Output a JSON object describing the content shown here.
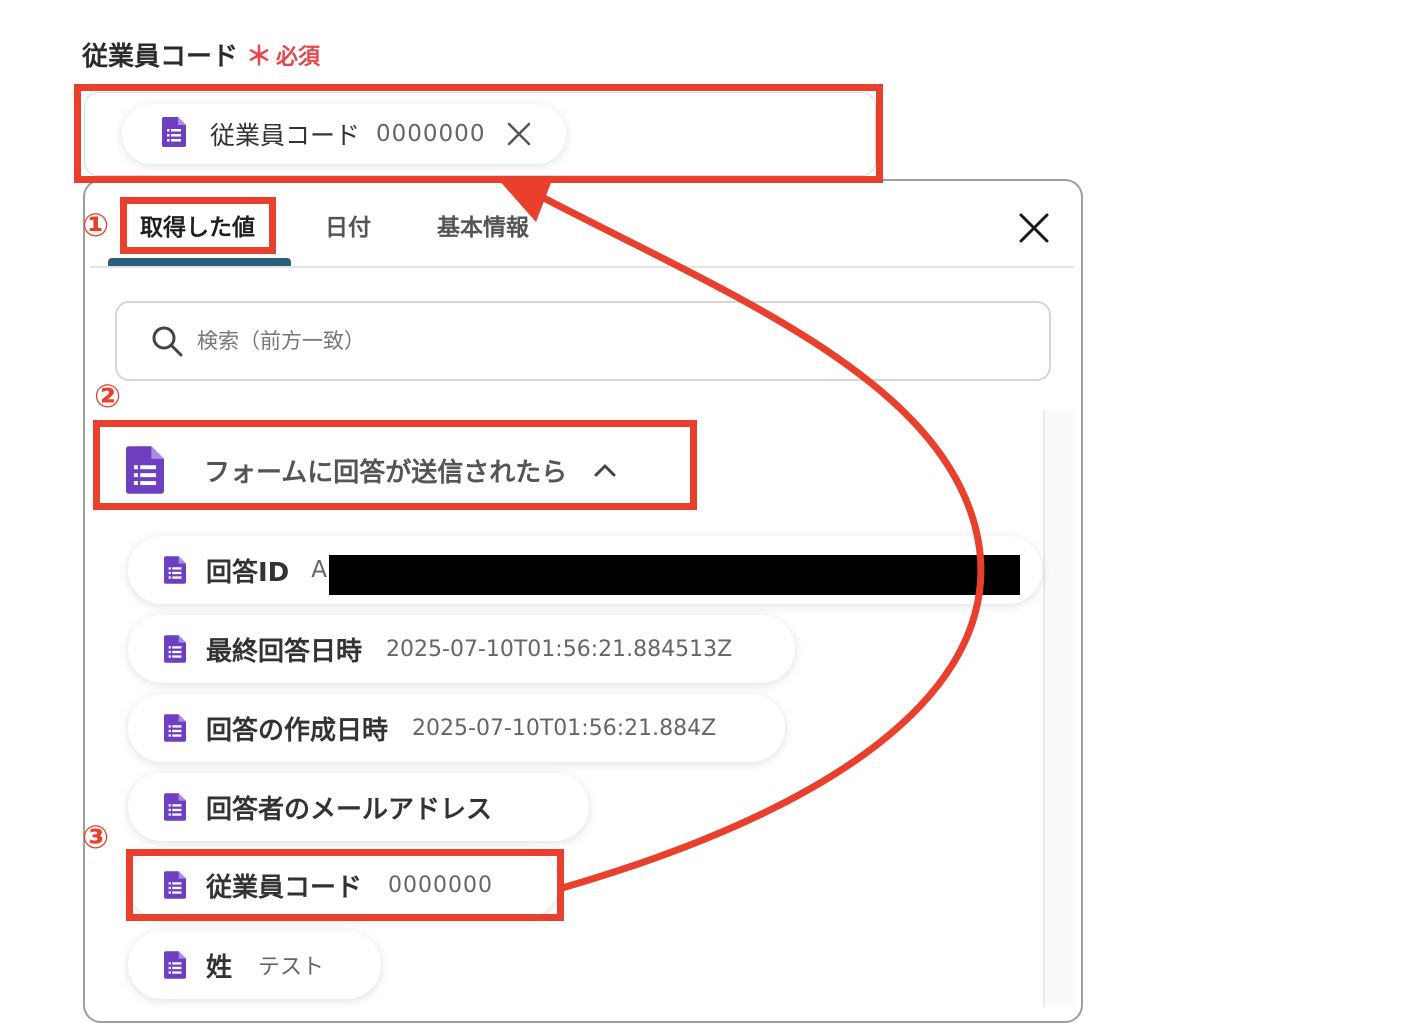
{
  "field": {
    "label": "従業員コード",
    "required_mark": "＊",
    "required_text": "必須",
    "chip": {
      "name": "従業員コード",
      "value": "0000000",
      "icon": "google-forms-icon",
      "remove_icon": "close-icon"
    }
  },
  "tabs": [
    {
      "label": "取得した値",
      "active": true
    },
    {
      "label": "日付",
      "active": false
    },
    {
      "label": "基本情報",
      "active": false
    }
  ],
  "search": {
    "placeholder": "検索（前方一致）",
    "icon": "search-icon"
  },
  "group": {
    "label": "フォームに回答が送信されたら",
    "icon": "google-forms-icon",
    "toggle_icon": "chevron-up-icon"
  },
  "items": [
    {
      "name": "回答ID",
      "value": "A"
    },
    {
      "name": "最終回答日時",
      "value": "2025-07-10T01:56:21.884513Z"
    },
    {
      "name": "回答の作成日時",
      "value": "2025-07-10T01:56:21.884Z"
    },
    {
      "name": "回答者のメールアドレス",
      "value": ""
    },
    {
      "name": "従業員コード",
      "value": "0000000"
    },
    {
      "name": "姓",
      "value": "テスト"
    }
  ],
  "annotations": {
    "step1": "①",
    "step2": "②",
    "step3": "③"
  },
  "colors": {
    "accent_red": "#e8402c",
    "required_red": "#e8454c",
    "tab_underline": "#2d5f7d",
    "forms_purple": "#6f3fc2"
  }
}
